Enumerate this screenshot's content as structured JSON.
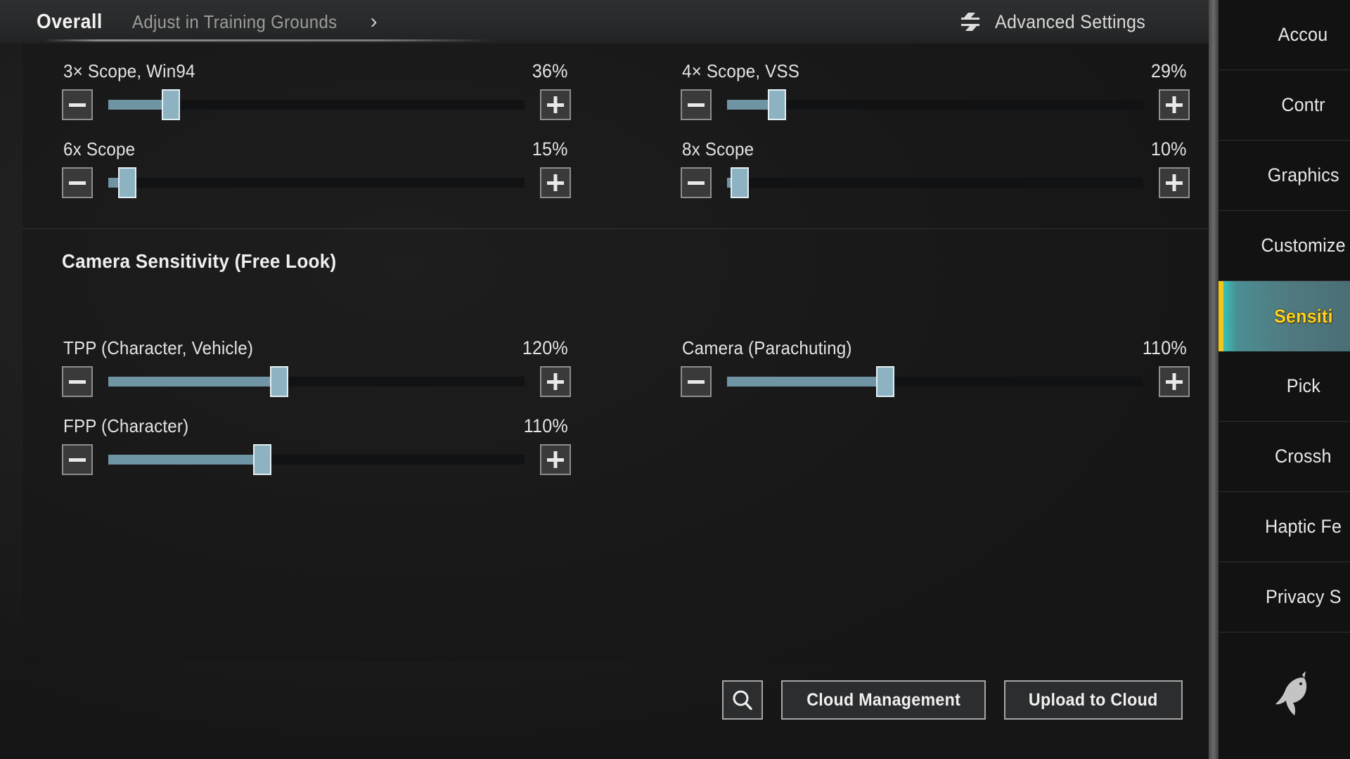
{
  "header": {
    "tab_overall": "Overall",
    "tab_training": "Adjust in Training Grounds",
    "chevron": "›",
    "advanced_settings": "Advanced Settings",
    "swap_icon": "swap-arrows-icon"
  },
  "scopes": {
    "sliders": [
      {
        "label": "3× Scope, Win94",
        "value": "36%",
        "percent": 36
      },
      {
        "label": "4× Scope, VSS",
        "value": "29%",
        "percent": 29
      },
      {
        "label": "6x Scope",
        "value": "15%",
        "percent": 15
      },
      {
        "label": "8x Scope",
        "value": "10%",
        "percent": 10
      }
    ]
  },
  "camera": {
    "title": "Camera Sensitivity (Free Look)",
    "sliders": [
      {
        "label": "TPP (Character, Vehicle)",
        "value": "120%",
        "percent": 41
      },
      {
        "label": "Camera (Parachuting)",
        "value": "110%",
        "percent": 38
      },
      {
        "label": "FPP (Character)",
        "value": "110%",
        "percent": 37
      }
    ]
  },
  "actions": {
    "search_icon": "search-icon",
    "cloud_management": "Cloud Management",
    "upload_to_cloud": "Upload to Cloud"
  },
  "sidebar": {
    "items": [
      {
        "label": "Accou",
        "active": false
      },
      {
        "label": "Contr",
        "active": false
      },
      {
        "label": "Graphics",
        "active": false
      },
      {
        "label": "Customize",
        "active": false
      },
      {
        "label": "Sensiti",
        "active": true
      },
      {
        "label": "Pick",
        "active": false
      },
      {
        "label": "Crossh",
        "active": false
      },
      {
        "label": "Haptic Fe",
        "active": false
      },
      {
        "label": "Privacy S",
        "active": false
      }
    ],
    "watermark_icon": "unicorn-icon"
  },
  "colors": {
    "accent_teal": "#4b8e93",
    "accent_yellow": "#ffd21e",
    "slider_fill": "#6f94a4",
    "slider_knob": "#8db3c3",
    "panel_bg": "#161616"
  }
}
